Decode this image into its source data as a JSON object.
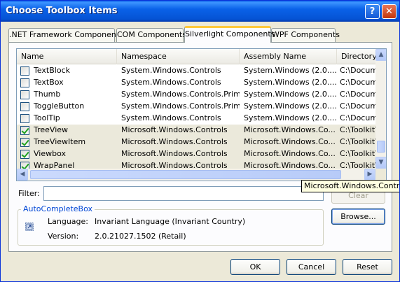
{
  "window": {
    "title": "Choose Toolbox Items"
  },
  "tabs": [
    {
      "label": ".NET Framework Components"
    },
    {
      "label": "COM Components"
    },
    {
      "label": "Silverlight Components"
    },
    {
      "label": "WPF Components"
    }
  ],
  "grid": {
    "columns": [
      "Name",
      "Namespace",
      "Assembly Name",
      "Directory"
    ],
    "rows": [
      {
        "checked": false,
        "name": "TextBlock",
        "namespace": "System.Windows.Controls",
        "assembly": "System.Windows (2.0....",
        "directory": "C:\\Docum"
      },
      {
        "checked": false,
        "name": "TextBox",
        "namespace": "System.Windows.Controls",
        "assembly": "System.Windows (2.0....",
        "directory": "C:\\Docum"
      },
      {
        "checked": false,
        "name": "Thumb",
        "namespace": "System.Windows.Controls.Prim...",
        "assembly": "System.Windows (2.0....",
        "directory": "C:\\Docum"
      },
      {
        "checked": false,
        "name": "ToggleButton",
        "namespace": "System.Windows.Controls.Prim...",
        "assembly": "System.Windows (2.0....",
        "directory": "C:\\Docum"
      },
      {
        "checked": false,
        "name": "ToolTip",
        "namespace": "System.Windows.Controls",
        "assembly": "System.Windows (2.0....",
        "directory": "C:\\Docum"
      },
      {
        "checked": true,
        "name": "TreeView",
        "namespace": "Microsoft.Windows.Controls",
        "assembly": "Microsoft.Windows.Co...",
        "directory": "C:\\Toolkit\\"
      },
      {
        "checked": true,
        "name": "TreeViewItem",
        "namespace": "Microsoft.Windows.Controls",
        "assembly": "Microsoft.Windows.Co...",
        "directory": "C:\\Toolkit\\"
      },
      {
        "checked": true,
        "name": "Viewbox",
        "namespace": "Microsoft.Windows.Controls",
        "assembly": "Microsoft.Windows.Co...",
        "directory": "C:\\Toolkit\\"
      },
      {
        "checked": true,
        "name": "WrapPanel",
        "namespace": "Microsoft.Windows.Controls",
        "assembly": "Microsoft.Windows.Co...",
        "directory": "C:\\Toolkit\\"
      }
    ]
  },
  "tooltip": {
    "text": "Microsoft.Windows.Controls"
  },
  "filter": {
    "label": "Filter:",
    "value": ""
  },
  "clear_button": {
    "label": "Clear"
  },
  "browse_button": {
    "label": "Browse..."
  },
  "component_info": {
    "title": "AutoCompleteBox",
    "language_label": "Language:",
    "language_value": "Invariant Language (Invariant Country)",
    "version_label": "Version:",
    "version_value": "2.0.21027.1502 (Retail)"
  },
  "dialog_buttons": {
    "ok": "OK",
    "cancel": "Cancel",
    "reset": "Reset"
  },
  "colors": {
    "titlebar": "#0a5fe6",
    "tab_active_accent": "#ffc83c",
    "selected_row": "#ebe9db",
    "group_title": "#0046d5",
    "check": "#21a121"
  }
}
